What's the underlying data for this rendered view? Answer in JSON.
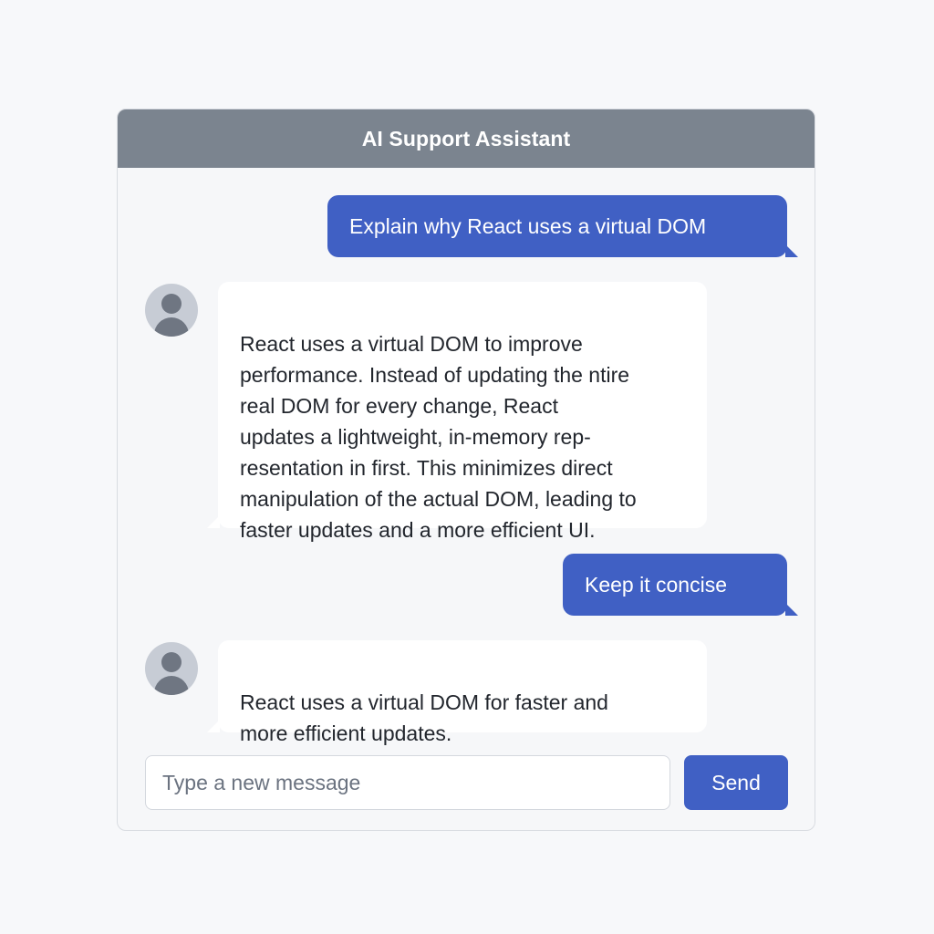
{
  "header": {
    "title": "AI Support Assistant"
  },
  "messages": [
    {
      "role": "user",
      "text": "Explain why React uses a virtual DOM"
    },
    {
      "role": "assistant",
      "text": "React uses a virtual DOM to improve\nperformance. Instead of updating the ntire\nreal DOM for every change, React\nupdates a lightweight, in-memory rep-\nresentation in first. This minimizes direct\nmanipulation of the actual DOM, leading to\nfaster updates and a more efficient UI."
    },
    {
      "role": "user",
      "text": "Keep it concise"
    },
    {
      "role": "assistant",
      "text": "React uses a virtual DOM for faster and\nmore efficient updates."
    }
  ],
  "composer": {
    "placeholder": "Type a new message",
    "value": "",
    "send_label": "Send"
  },
  "icons": {
    "avatar": "user-avatar-icon"
  },
  "colors": {
    "accent": "#4060c4",
    "header": "#7b848f",
    "background": "#f7f8fa"
  }
}
